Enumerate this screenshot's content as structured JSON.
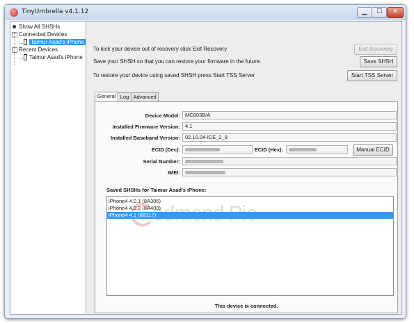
{
  "window": {
    "title": "TinyUmbrella v4.1.12",
    "min_glyph": "▁",
    "max_glyph": "☐",
    "close_glyph": "✕"
  },
  "tree": {
    "show_all": "Show All SHSHs",
    "connected_header": "Connected Devices",
    "connected_device": "Taimur Asad's iPhone",
    "recent_header": "Recent Devices",
    "recent_device": "Taimur Asad's iPhone",
    "collapse_glyph": "−"
  },
  "actions": {
    "exit_recovery_hint": "To kick your device out of recovery click Exit Recovery",
    "exit_recovery_label": "Exit Recovery",
    "save_shsh_hint": "Save your SHSH so that you can restore your firmware in the future.",
    "save_shsh_label": "Save SHSH",
    "tss_hint": "To restore your device using saved SHSH press Start TSS Server",
    "tss_label": "Start TSS Server"
  },
  "tabs": [
    "General",
    "Log",
    "Advanced"
  ],
  "general": {
    "device_model_label": "Device Model:",
    "device_model": "MC603B/A",
    "firmware_label": "Installed Firmware Version:",
    "firmware": "4.1",
    "baseband_label": "Installed Baseband Version:",
    "baseband": "02.10.04-ICE_2_8",
    "ecid_dec_label": "ECID (Dec):",
    "ecid_hex_label": "ECID (Hex):",
    "manual_ecid_label": "Manual ECID",
    "serial_label": "Serial Number:",
    "imei_label": "IMEI:"
  },
  "saved": {
    "title": "Saved SHSHs for Taimur Asad's iPhone:",
    "items": [
      "iPhone4 4.0.1 (8A306)",
      "iPhone4 4.0.2 (8A400)",
      "iPhone4 4.1 (8B117)"
    ],
    "selected_index": 2,
    "watermark": "edmond Pie"
  },
  "status": "This device is connected.",
  "colors": {
    "selection": "#3399ff",
    "window_frame": "#c7d6ea"
  }
}
